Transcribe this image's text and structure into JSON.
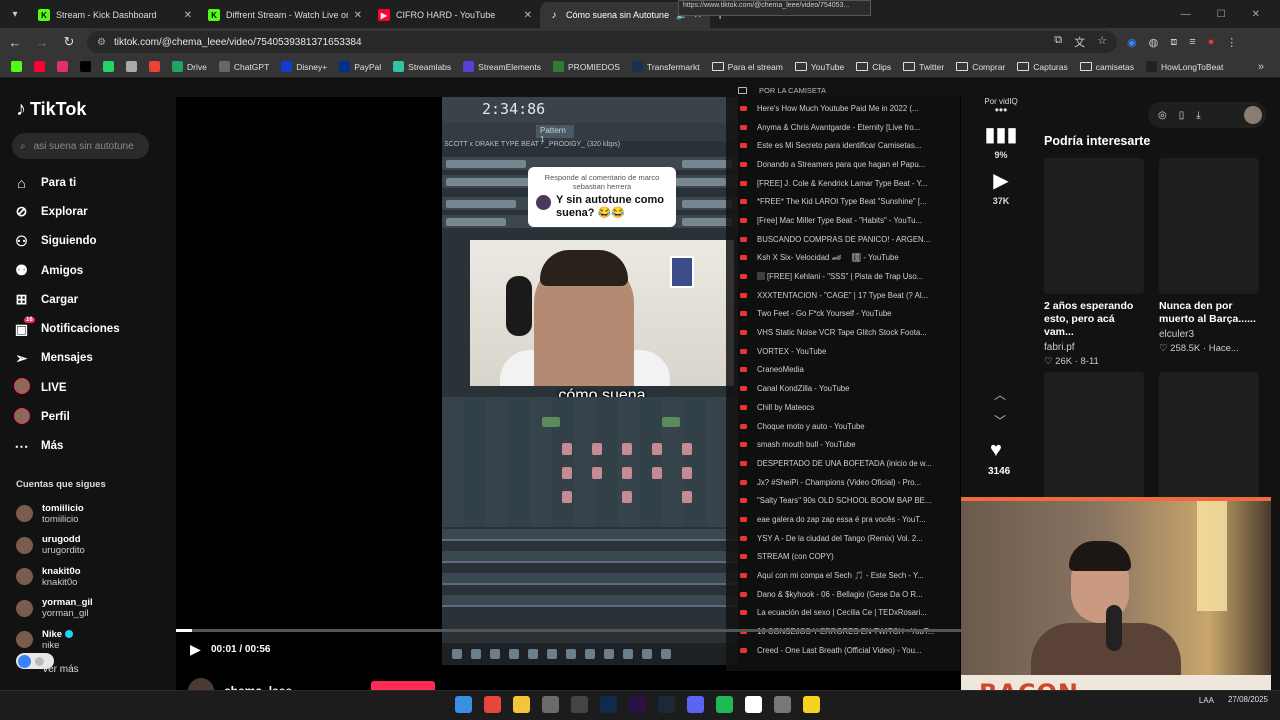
{
  "browser": {
    "tabs": [
      {
        "label": "Stream - Kick Dashboard",
        "icon": "kick-icon",
        "color": "#53fc18"
      },
      {
        "label": "Diffrent Stream - Watch Live on",
        "icon": "kick-icon",
        "color": "#53fc18"
      },
      {
        "label": "CIFRO HARD - YouTube",
        "icon": "youtube-icon",
        "color": "#ff0033"
      },
      {
        "label": "Cómo suena sin Autotune",
        "icon": "tiktok-icon",
        "color": "#ffffff"
      }
    ],
    "url": "tiktok.com/@chema_leee/video/7540539381371653384",
    "hover_url_tooltip": "https://www.tiktok.com/@chema_leee/video/754053...",
    "bookmarks": [
      {
        "label": "",
        "type": "icon",
        "color": "#53fc18"
      },
      {
        "label": "",
        "type": "icon",
        "color": "#ff0033"
      },
      {
        "label": "",
        "type": "icon",
        "color": "#e1306c"
      },
      {
        "label": "",
        "type": "icon",
        "color": "#000000"
      },
      {
        "label": "",
        "type": "icon",
        "color": "#25d366"
      },
      {
        "label": "",
        "type": "icon",
        "color": "#aaaaaa"
      },
      {
        "label": "",
        "type": "icon",
        "color": "#ea4335"
      },
      {
        "label": "Drive",
        "type": "icon",
        "color": "#1fa463"
      },
      {
        "label": "ChatGPT",
        "type": "icon",
        "color": "#666666"
      },
      {
        "label": "Disney+",
        "type": "icon",
        "color": "#113ccf"
      },
      {
        "label": "PayPal",
        "type": "icon",
        "color": "#003087"
      },
      {
        "label": "Streamlabs",
        "type": "icon",
        "color": "#31c3a2"
      },
      {
        "label": "StreamElements",
        "type": "icon",
        "color": "#5a3fd6"
      },
      {
        "label": "PROMIEDOS",
        "type": "icon",
        "color": "#2e7d32"
      },
      {
        "label": "Transfermarkt",
        "type": "icon",
        "color": "#1a3151"
      },
      {
        "label": "Para el stream",
        "type": "folder"
      },
      {
        "label": "YouTube",
        "type": "folder"
      },
      {
        "label": "Clips",
        "type": "folder"
      },
      {
        "label": "Twitter",
        "type": "folder"
      },
      {
        "label": "Comprar",
        "type": "folder"
      },
      {
        "label": "Capturas",
        "type": "folder"
      },
      {
        "label": "camisetas",
        "type": "folder"
      },
      {
        "label": "HowLongToBeat",
        "type": "icon",
        "color": "#222222"
      }
    ]
  },
  "tiktok": {
    "logo": "TikTok",
    "search_placeholder": "asi suena sin autotune",
    "menu": [
      {
        "label": "Para ti",
        "icon": "home-icon"
      },
      {
        "label": "Explorar",
        "icon": "compass-icon"
      },
      {
        "label": "Siguiendo",
        "icon": "following-icon"
      },
      {
        "label": "Amigos",
        "icon": "friends-icon"
      },
      {
        "label": "Cargar",
        "icon": "upload-icon"
      },
      {
        "label": "Notificaciones",
        "icon": "inbox-icon",
        "badge": "16"
      },
      {
        "label": "Mensajes",
        "icon": "send-icon"
      },
      {
        "label": "LIVE",
        "icon": "live-icon"
      },
      {
        "label": "Perfil",
        "icon": "profile-icon"
      },
      {
        "label": "Más",
        "icon": "more-icon"
      }
    ],
    "following_title": "Cuentas que sigues",
    "following": [
      {
        "username": "tomiilicio",
        "nickname": "tomiilicio"
      },
      {
        "username": "urugodd",
        "nickname": "urugordito"
      },
      {
        "username": "knakit0o",
        "nickname": "knakit0o"
      },
      {
        "username": "yorman_gil",
        "nickname": "yorman_gil"
      },
      {
        "username": "Nike",
        "nickname": "nike",
        "verified": true
      }
    ],
    "see_more": "Ver más",
    "video": {
      "fl_time": "2:34:86",
      "fl_pattern": "Pattern 1",
      "fl_beat_name": "SCOTT x DRAKE TYPE BEAT - _PRODIGY_ (320 kbps)",
      "comment_reply": "Responde al comentario de marco sebastian herrera",
      "comment_text": "Y sin autotune como suena? 😂😂",
      "caption": "cómo suena",
      "current_time": "00:01",
      "duration": "00:56",
      "time_label": "00:01 / 00:56",
      "progress": 0.02,
      "author": "chema_leee"
    },
    "actions": {
      "vidiq_label": "Por vidIQ",
      "vidiq_score": "9%",
      "views": "37K",
      "likes": "3146"
    },
    "right_panel": {
      "title": "Podría interesarte",
      "recommendations": [
        {
          "title": "2 años esperando esto, pero acá vam...",
          "author": "fabri.pf",
          "stats": "♡ 26K · 8-11"
        },
        {
          "title": "Nunca den por muerto al Barça......",
          "author": "elculer3",
          "stats": "♡ 258.5K · Hace..."
        },
        {
          "title": "",
          "author": "",
          "stats": ""
        },
        {
          "title": "",
          "author": "",
          "stats": ""
        }
      ]
    }
  },
  "yt_history": {
    "header": "POR LA CAMISETA",
    "items": [
      "Here's How Much Youtube Paid Me in 2022 (...",
      "Anyma & Chris Avantgarde - Eternity [Live fro...",
      "Este es Mi Secreto para identificar Camisetas...",
      "Donando a Streamers para que hagan el Papu...",
      "[FREE] J. Cole & Kendrick Lamar Type Beat - Y...",
      "*FREE* The Kid LAROI Type Beat \"Sunshine\" [...",
      "[Free] Mac Miller Type Beat - \"Habits\" - YouTu...",
      "BUSCANDO COMPRAS DE PANICO! - ARGEN...",
      "Ksh X Six- Velocidad 🏎 🏽 - YouTube",
      "🏽 [FREE] Kehlani - \"SSS\" | Pista de Trap Uso...",
      "XXXTENTACION - \"CAGE\" | 17 Type Beat (? Al...",
      "Two Feet - Go F*ck Yourself - YouTube",
      "VHS Static Noise VCR Tape Glitch Stock Foota...",
      "VORTEX - YouTube",
      "CraneoMedia",
      "Canal KondZilla - YouTube",
      "Chill by Mateocs",
      "Choque moto y auto - YouTube",
      "smash mouth bull - YouTube",
      "DESPERTADO DE UNA BOFETADA (inicio de w...",
      "Jx? #SheiPi - Champions (Video Oficial) - Pro...",
      "\"Salty Tears\" 90s OLD SCHOOL BOOM BAP BE...",
      "eae galera do zap zap essa é pra vocês - YouT...",
      "YSY A - De la ciudad del Tango (Remix) Vol. 2...",
      "STREAM (con COPY)",
      "Aquí con mi compa el Sech 🎵 - Este Sech - Y...",
      "Dano & $kyhook - 06 - Bellagio (Gese Da O R...",
      "La ecuación del sexo | Cecilia Ce | TEDxRosari...",
      "10 CONSEJOS Y ERRORES EN TWITCH - YouT...",
      "Creed - One Last Breath (Official Video) - You..."
    ]
  },
  "webcam": {
    "overlay_text": "BACON"
  },
  "taskbar": {
    "apps": [
      {
        "icon": "windows-icon",
        "color": "#3a8ee6"
      },
      {
        "icon": "chrome-icon",
        "color": "#e8453c"
      },
      {
        "icon": "folder-icon",
        "color": "#f3c43c"
      },
      {
        "icon": "app-icon",
        "color": "#6a6a6a"
      },
      {
        "icon": "obs-icon",
        "color": "#444444"
      },
      {
        "icon": "photoshop-icon",
        "color": "#0f2a4a"
      },
      {
        "icon": "premiere-icon",
        "color": "#2a1245"
      },
      {
        "icon": "steam-icon",
        "color": "#1b2838"
      },
      {
        "icon": "discord-icon",
        "color": "#5865f2"
      },
      {
        "icon": "spotify-icon",
        "color": "#1db954"
      },
      {
        "icon": "notion-icon",
        "color": "#ffffff"
      },
      {
        "icon": "settings-icon",
        "color": "#777777"
      },
      {
        "icon": "sticky-notes-icon",
        "color": "#f6d31f"
      }
    ],
    "lang": "LAA",
    "date": "27/08/2025"
  }
}
